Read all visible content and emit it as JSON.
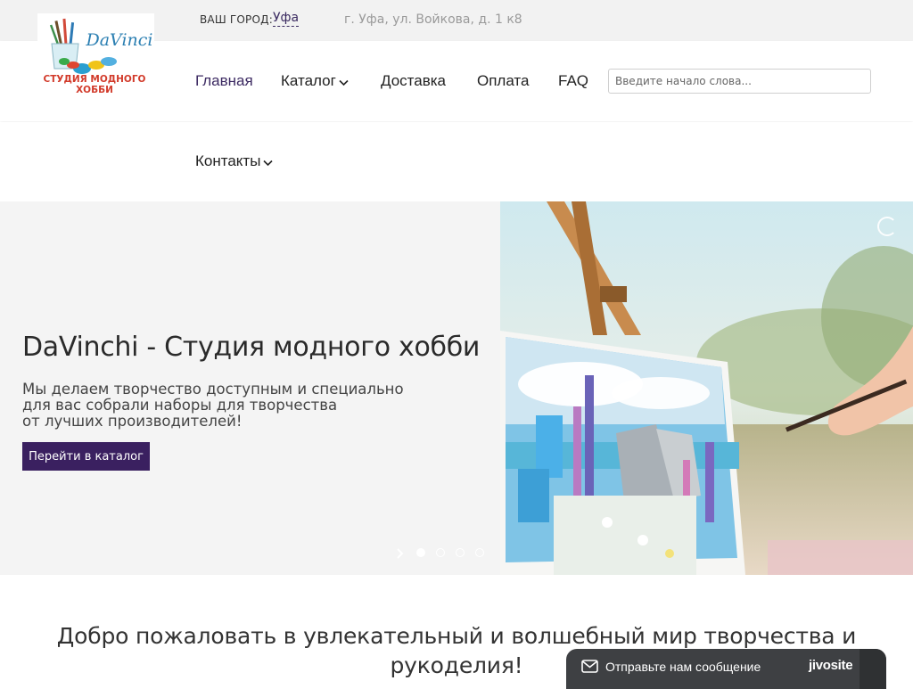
{
  "topbar": {
    "city_label": "ВАШ ГОРОД:",
    "city_value": "Уфа",
    "address": "г. Уфа, ул. Войкова, д. 1 к8"
  },
  "logo": {
    "brand_text": "DaVinci",
    "line1": "СТУДИЯ МОДНОГО",
    "line2": "ХОББИ"
  },
  "nav": {
    "items": [
      {
        "label": "Главная",
        "active": true
      },
      {
        "label": "Каталог",
        "dropdown": true
      },
      {
        "label": "Доставка"
      },
      {
        "label": "Оплата"
      },
      {
        "label": "FAQ"
      },
      {
        "label": "Контакты",
        "dropdown": true
      }
    ],
    "search_placeholder": "Введите начало слова..."
  },
  "hero": {
    "title": "DaVinchi - Студия модного хобби",
    "text_lines": [
      "Мы делаем творчество доступным и специально",
      "для вас собрали наборы для творчества",
      "от лучших производителей!"
    ],
    "button_label": "Перейти в каталог",
    "slides_count": 4,
    "active_slide": 1
  },
  "welcome": {
    "line1": "Добро пожаловать в увлекательный и волшебный мир творчества и",
    "line2": "рукоделия!"
  },
  "chat": {
    "label": "Отправьте нам сообщение",
    "brand": "jivosite"
  },
  "colors": {
    "accent": "#3a2060",
    "topbar_bg": "#f2f2f2",
    "hero_bg": "#f4f4f4",
    "chat_bg": "#3e4043"
  }
}
